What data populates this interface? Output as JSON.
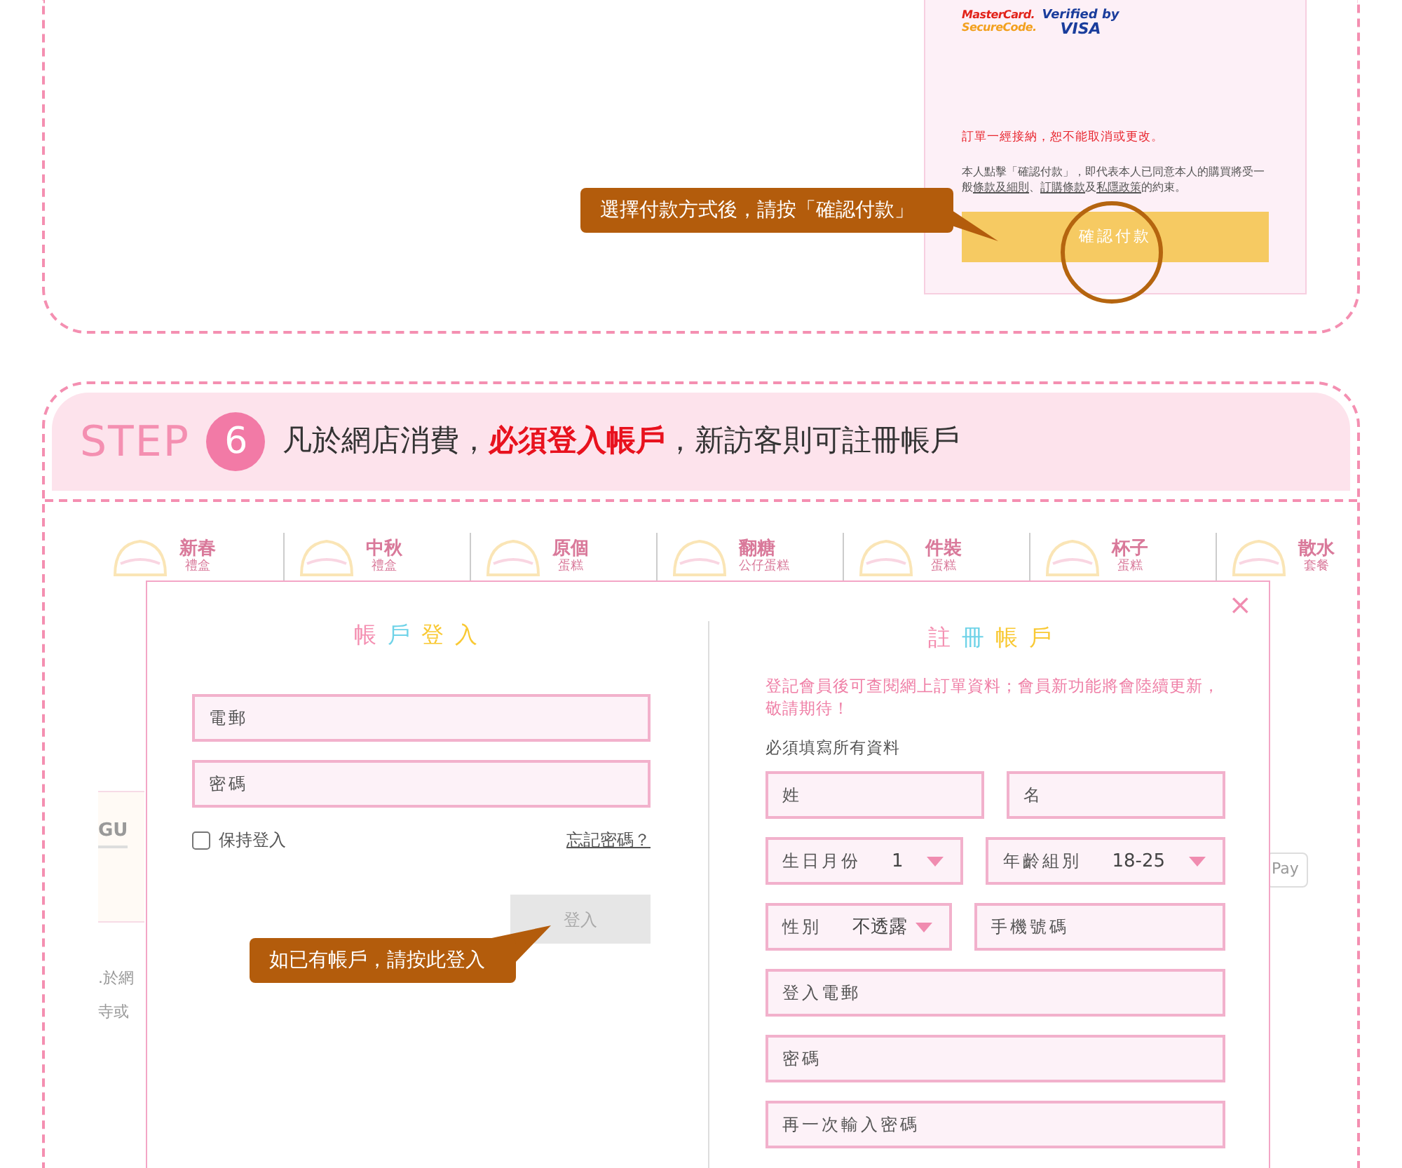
{
  "payment_panel": {
    "mastercard_logo": [
      "MasterCard.",
      "SecureCode."
    ],
    "visa_logo": [
      "Verified by",
      "VISA"
    ],
    "notice": "訂單一經接納，恕不能取消或更改。",
    "agreement": [
      {
        "text": "本人點擊「確認付款」，即代表本人已同意本人的購買將受一般",
        "kind": "plain"
      },
      {
        "text": "條款及細則",
        "kind": "link"
      },
      {
        "text": "、",
        "kind": "plain"
      },
      {
        "text": "訂購條款",
        "kind": "link"
      },
      {
        "text": "及",
        "kind": "plain"
      },
      {
        "text": "私隱政策",
        "kind": "link"
      },
      {
        "text": "的約束。",
        "kind": "plain"
      }
    ],
    "confirm_button": "確認付款",
    "callout": "選擇付款方式後，請按「確認付款」"
  },
  "step": {
    "label": "STEP",
    "number": "6",
    "heading": [
      {
        "text": "凡於網店消費，",
        "emphasis": false
      },
      {
        "text": "必須登入帳戶",
        "emphasis": true
      },
      {
        "text": "，新訪客則可註冊帳戶",
        "emphasis": false
      }
    ]
  },
  "categories": [
    {
      "name": "新春",
      "sub": "禮盒"
    },
    {
      "name": "中秋",
      "sub": "禮盒"
    },
    {
      "name": "原個",
      "sub": "蛋糕"
    },
    {
      "name": "翻糖",
      "sub": "公仔蛋糕"
    },
    {
      "name": "件裝",
      "sub": "蛋糕"
    },
    {
      "name": "杯子",
      "sub": "蛋糕"
    },
    {
      "name": "散水",
      "sub": "套餐"
    }
  ],
  "background_fragments": {
    "card_text": "GU",
    "lines": [
      ".於網",
      "寺或"
    ],
    "badge": "Pay"
  },
  "modal": {
    "close": "×",
    "login": {
      "title": [
        {
          "text": "帳",
          "color": "#f48fb1"
        },
        {
          "text": "戶",
          "color": "#6fd3e8"
        },
        {
          "text": "登",
          "color": "#f9c934"
        },
        {
          "text": "入",
          "color": "#f9c934"
        }
      ],
      "fields": [
        {
          "placeholder": "電郵"
        },
        {
          "placeholder": "密碼"
        }
      ],
      "remember": {
        "label": "保持登入",
        "checked": false
      },
      "forgot": "忘記密碼？",
      "button": {
        "label": "登入",
        "disabled": true
      },
      "callout": "如已有帳戶，請按此登入"
    },
    "register": {
      "title": [
        {
          "text": "註",
          "color": "#f48fb1"
        },
        {
          "text": "冊",
          "color": "#6fd3e8"
        },
        {
          "text": "帳",
          "color": "#f9c934"
        },
        {
          "text": "戶",
          "color": "#f9c934"
        }
      ],
      "note": "登記會員後可查閱網上訂單資料；會員新功能將會陸續更新，敬請期待！",
      "required": "必須填寫所有資料",
      "rows": [
        [
          {
            "kind": "input",
            "placeholder": "姓"
          },
          {
            "kind": "input",
            "placeholder": "名"
          }
        ],
        [
          {
            "kind": "select",
            "label": "生日月份",
            "value": "1"
          },
          {
            "kind": "select",
            "label": "年齡組別",
            "value": "18-25"
          }
        ],
        [
          {
            "kind": "select",
            "label": "性別",
            "value": "不透露"
          },
          {
            "kind": "input",
            "placeholder": "手機號碼"
          }
        ],
        [
          {
            "kind": "input",
            "placeholder": "登入電郵"
          }
        ],
        [
          {
            "kind": "input",
            "placeholder": "密碼"
          }
        ],
        [
          {
            "kind": "input",
            "placeholder": "再一次輸入密碼"
          }
        ]
      ]
    }
  }
}
